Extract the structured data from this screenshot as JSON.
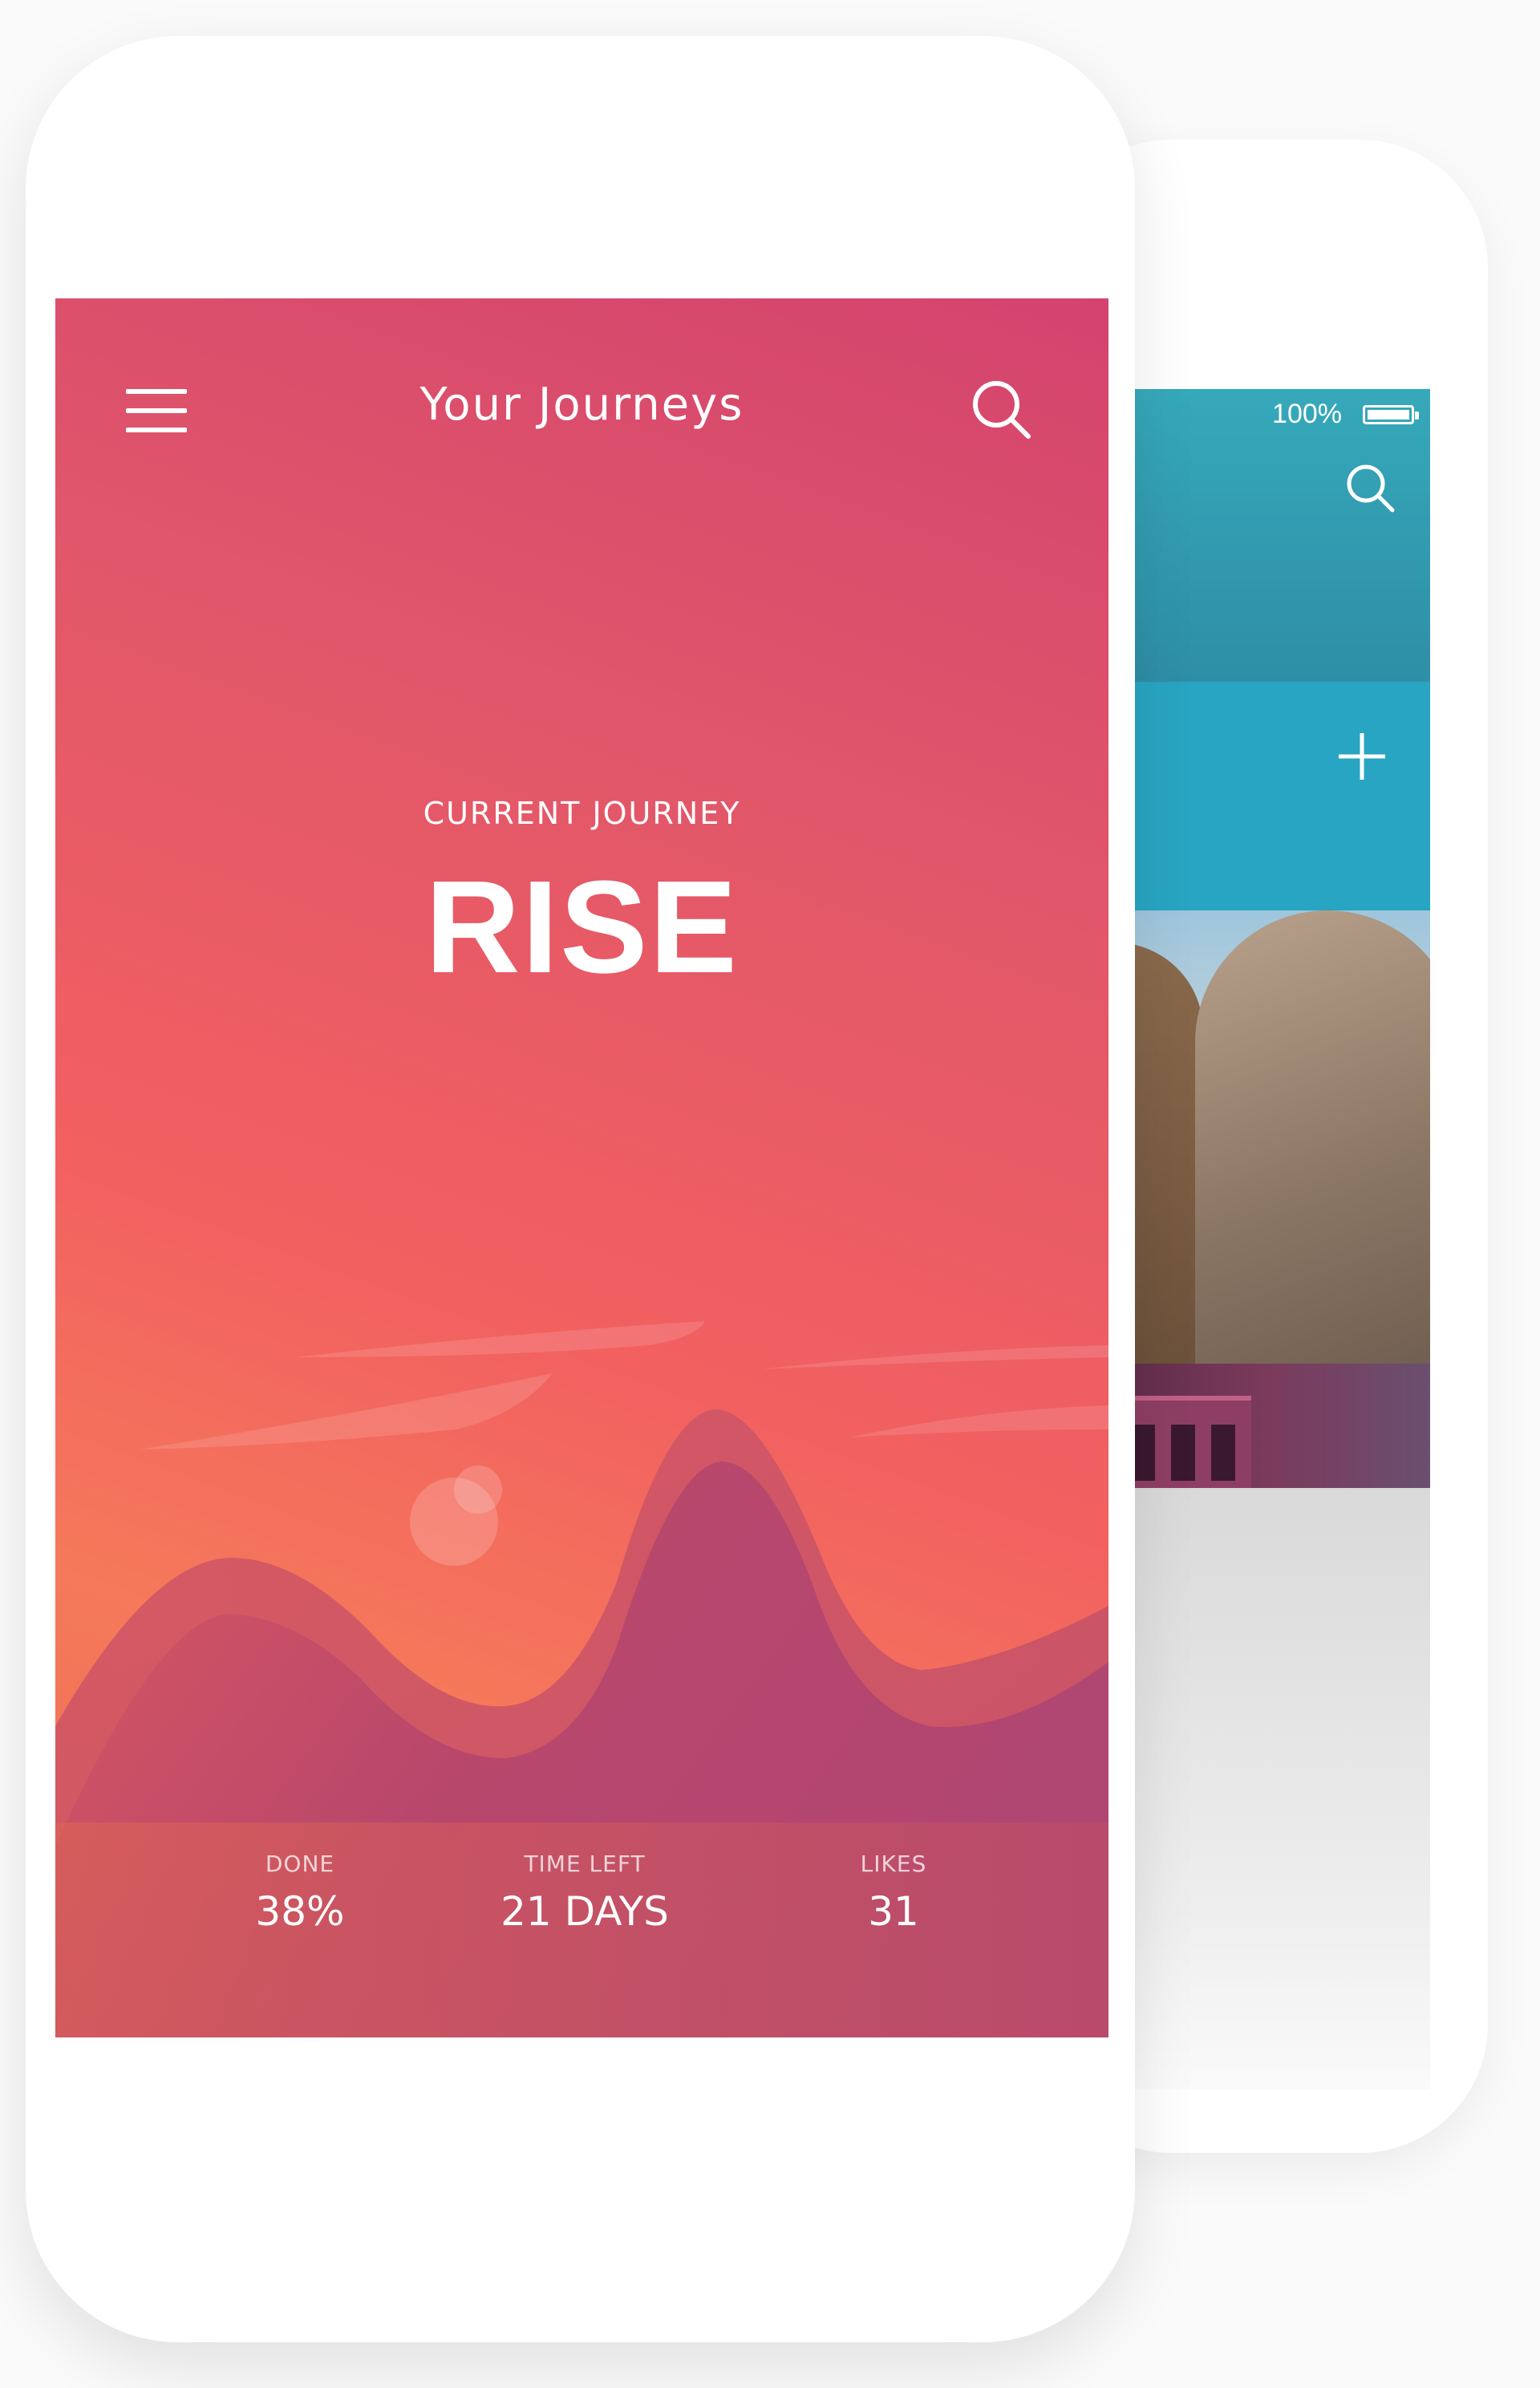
{
  "header": {
    "title": "Your Journeys",
    "menu_icon": "hamburger-menu-icon",
    "search_icon": "search-icon"
  },
  "journey": {
    "label": "CURRENT JOURNEY",
    "name": "RISE"
  },
  "stats": [
    {
      "label": "DONE",
      "value": "38%"
    },
    {
      "label": "TIME LEFT",
      "value": "21 DAYS"
    },
    {
      "label": "LIKES",
      "value": "31"
    }
  ],
  "back_phone": {
    "battery_percent": "100%",
    "search_icon": "search-icon",
    "add_icon": "plus-icon"
  },
  "colors": {
    "gradient_top": "#d4436e",
    "gradient_bottom": "#f5795a",
    "wave_purple": "#b5466f",
    "back_header": "#36a9bb",
    "back_band": "#28a5c2"
  }
}
